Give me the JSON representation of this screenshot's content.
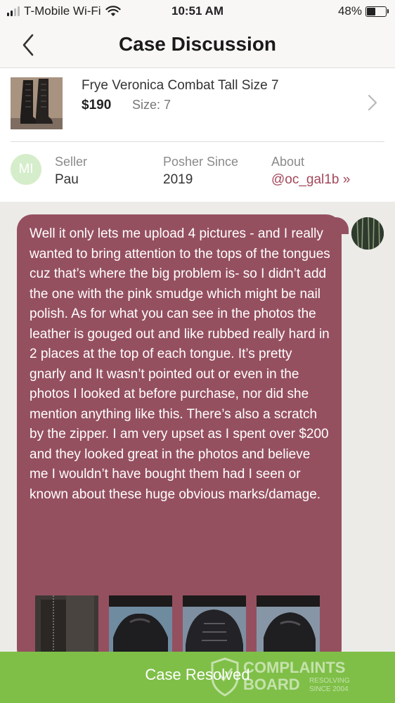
{
  "status_bar": {
    "carrier": "T-Mobile Wi-Fi",
    "time": "10:51 AM",
    "battery_percent": "48%",
    "battery_level": 0.48,
    "icons": [
      "signal-icon",
      "wifi-icon",
      "battery-icon"
    ]
  },
  "header": {
    "title": "Case Discussion",
    "back_icon": "chevron-left-icon"
  },
  "product": {
    "title": "Frye Veronica Combat Tall Size 7",
    "price": "$190",
    "size_label": "Size:",
    "size_value": "7",
    "chevron_icon": "chevron-right-icon"
  },
  "seller": {
    "avatar_initials": "MI",
    "seller_label": "Seller",
    "seller_name": "Pau",
    "since_label": "Posher Since",
    "since_value": "2019",
    "about_label": "About",
    "about_link": "@oc_gal1b »"
  },
  "message": {
    "text": "Well it only lets me upload 4 pictures - and I really wanted to bring attention to the tops of the tongues cuz that’s where the big problem is- so I didn’t add the one with the pink smudge which might be nail polish. As for what you can see in the photos the leather is gouged out and like rubbed really hard in 2 places at the top of each tongue. It’s pretty gnarly and It wasn’t pointed out or even in the photos I looked at before purchase, nor did she mention anything like this. There’s also a scratch by the zipper. I am very upset as I spent over $200 and they looked great in the photos and believe me I wouldn’t have bought them had I seen or known about these huge obvious marks/damage.",
    "attachment_count": 4
  },
  "footer": {
    "label": "Case Resolved"
  },
  "watermark": {
    "line1": "COMPLAINTS",
    "line2": "BOARD",
    "line3": "RESOLVING",
    "line4": "SINCE 2004"
  },
  "colors": {
    "bubble": "#955060",
    "accent_link": "#a3475a",
    "footer": "#7fbf48",
    "avatar_bg": "#d5edca"
  }
}
